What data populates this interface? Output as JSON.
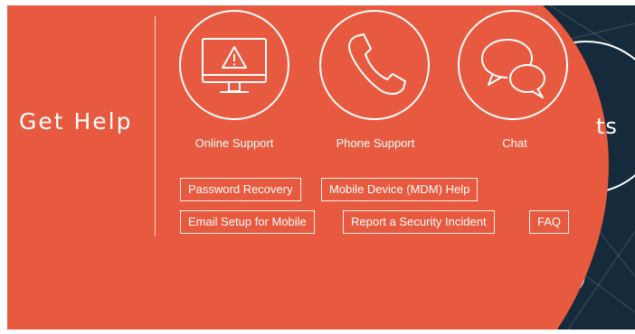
{
  "colors": {
    "accent": "#e85a3f",
    "dark_background": "#152a3a",
    "text": "#ffffff"
  },
  "section_title": "Get Help",
  "background_partial_text": "ts",
  "support_options": [
    {
      "label": "Online Support",
      "icon": "monitor-warning-icon"
    },
    {
      "label": "Phone Support",
      "icon": "phone-icon"
    },
    {
      "label": "Chat",
      "icon": "chat-bubbles-icon"
    }
  ],
  "quick_links": [
    {
      "label": "Password Recovery"
    },
    {
      "label": "Mobile Device (MDM) Help"
    },
    {
      "label": "Email Setup for Mobile"
    },
    {
      "label": "Report a Security Incident"
    },
    {
      "label": "FAQ"
    }
  ]
}
